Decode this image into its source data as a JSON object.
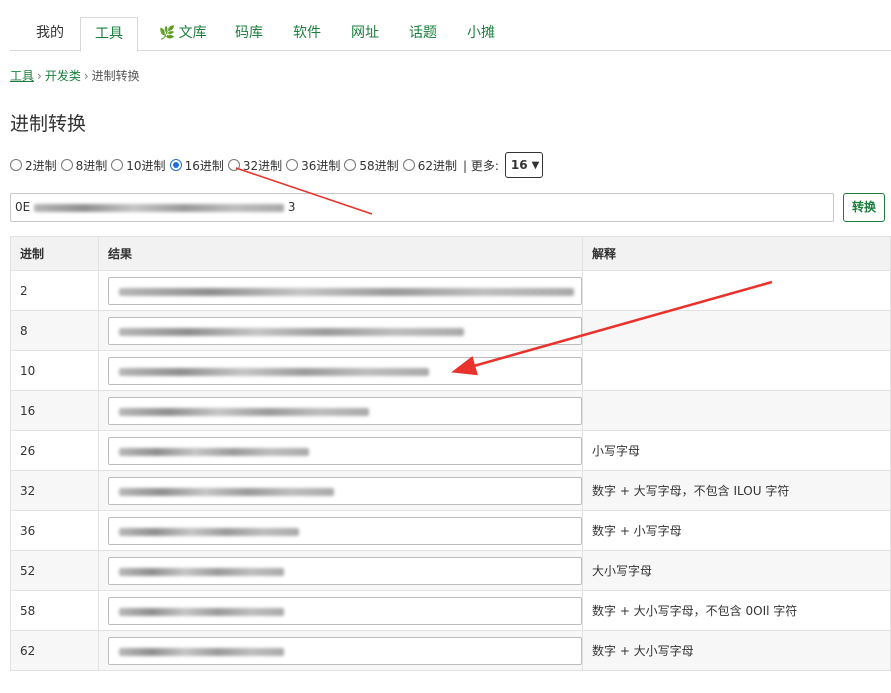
{
  "nav": {
    "tabs": [
      {
        "label": "我的"
      },
      {
        "label": "工具"
      },
      {
        "label": "文库"
      },
      {
        "label": "码库"
      },
      {
        "label": "软件"
      },
      {
        "label": "网址"
      },
      {
        "label": "话题"
      },
      {
        "label": "小摊"
      }
    ]
  },
  "breadcrumb": {
    "root": "工具",
    "category": "开发类",
    "current": "进制转换",
    "sep": "›"
  },
  "page": {
    "title": "进制转换"
  },
  "radix_options": [
    {
      "label": "2进制",
      "selected": false
    },
    {
      "label": "8进制",
      "selected": false
    },
    {
      "label": "10进制",
      "selected": false
    },
    {
      "label": "16进制",
      "selected": true
    },
    {
      "label": "32进制",
      "selected": false
    },
    {
      "label": "36进制",
      "selected": false
    },
    {
      "label": "58进制",
      "selected": false
    },
    {
      "label": "62进制",
      "selected": false
    }
  ],
  "more": {
    "label": "| 更多:",
    "select_value": "16"
  },
  "input": {
    "visible_prefix": "0E",
    "visible_suffix": "3"
  },
  "convert_button": "转换",
  "table": {
    "headers": [
      "进制",
      "结果",
      "解释"
    ],
    "rows": [
      {
        "base": "2",
        "note": ""
      },
      {
        "base": "8",
        "note": ""
      },
      {
        "base": "10",
        "note": ""
      },
      {
        "base": "16",
        "note": ""
      },
      {
        "base": "26",
        "note": "小写字母"
      },
      {
        "base": "32",
        "note": "数字 + 大写字母，不包含 ILOU 字符"
      },
      {
        "base": "36",
        "note": "数字 + 小写字母"
      },
      {
        "base": "52",
        "note": "大小写字母"
      },
      {
        "base": "58",
        "note": "数字 + 大小写字母，不包含 0OIl 字符"
      },
      {
        "base": "62",
        "note": "数字 + 大小写字母"
      }
    ]
  },
  "colors": {
    "accent": "#1a7f3c",
    "arrow": "#e8322b",
    "radio_selected": "#1e6fd9"
  }
}
